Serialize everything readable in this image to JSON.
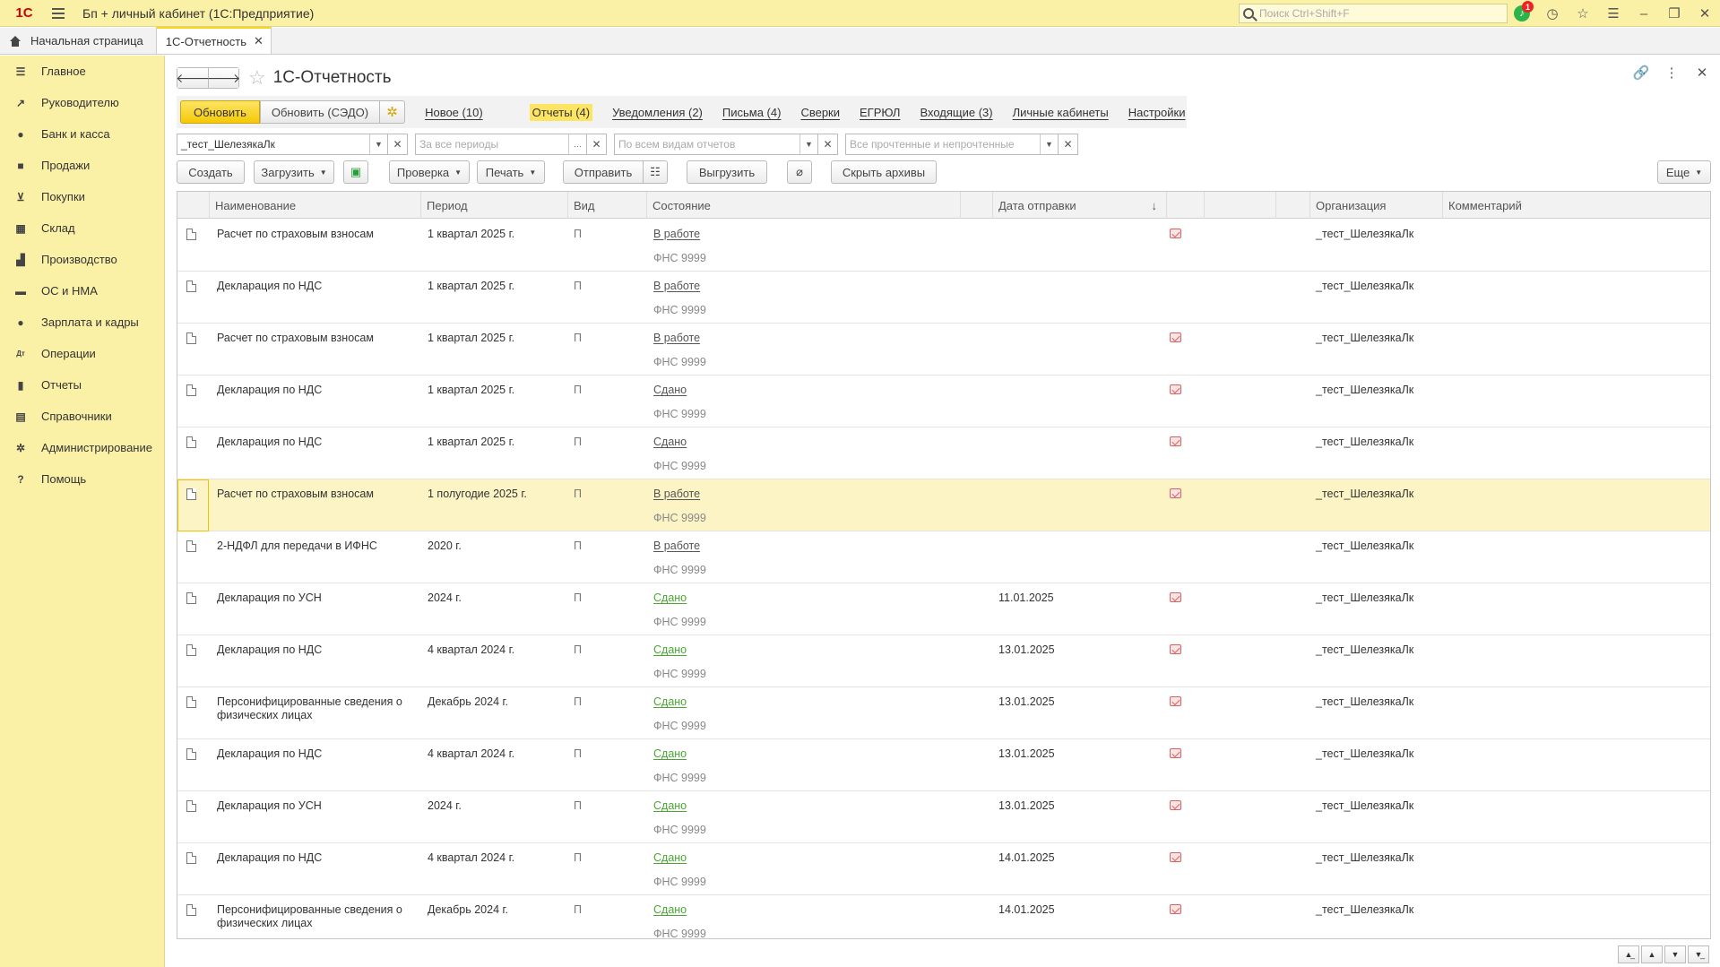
{
  "app": {
    "title": "Бп + личный кабинет  (1С:Предприятие)",
    "logo": "1С",
    "search_placeholder": "Поиск Ctrl+Shift+F",
    "notification_count": "1"
  },
  "tabs": {
    "home": "Начальная страница",
    "active": "1С-Отчетность"
  },
  "sidebar": {
    "items": [
      {
        "label": "Главное",
        "icon": "menu-icon"
      },
      {
        "label": "Руководителю",
        "icon": "trend-icon"
      },
      {
        "label": "Банк и касса",
        "icon": "coin-icon"
      },
      {
        "label": "Продажи",
        "icon": "bag-icon"
      },
      {
        "label": "Покупки",
        "icon": "cart-icon"
      },
      {
        "label": "Склад",
        "icon": "grid-icon"
      },
      {
        "label": "Производство",
        "icon": "factory-icon"
      },
      {
        "label": "ОС и НМА",
        "icon": "truck-icon"
      },
      {
        "label": "Зарплата и кадры",
        "icon": "person-icon"
      },
      {
        "label": "Операции",
        "icon": "dtkt-icon"
      },
      {
        "label": "Отчеты",
        "icon": "bars-icon"
      },
      {
        "label": "Справочники",
        "icon": "books-icon"
      },
      {
        "label": "Администрирование",
        "icon": "gear-icon"
      },
      {
        "label": "Помощь",
        "icon": "help-icon"
      }
    ]
  },
  "form": {
    "title": "1С-Отчетность"
  },
  "cmdbar1": {
    "refresh": "Обновить",
    "refresh_sedo": "Обновить (СЭДО)",
    "links": [
      "Новое (10)",
      "Отчеты (4)",
      "Уведомления (2)",
      "Письма (4)",
      "Сверки",
      "ЕГРЮЛ",
      "Входящие (3)",
      "Личные кабинеты",
      "Настройки"
    ]
  },
  "filters": {
    "org": "_тест_ШелезякаЛк",
    "period_placeholder": "За все периоды",
    "types_placeholder": "По всем видам отчетов",
    "read_placeholder": "Все прочтенные и непрочтенные"
  },
  "cmdbar2": {
    "create": "Создать",
    "load": "Загрузить",
    "check": "Проверка",
    "print": "Печать",
    "send": "Отправить",
    "export": "Выгрузить",
    "hide_archives": "Скрыть архивы",
    "more": "Еще"
  },
  "table": {
    "headers": {
      "name": "Наименование",
      "period": "Период",
      "kind": "Вид",
      "state": "Состояние",
      "sent": "Дата отправки",
      "org": "Организация",
      "comment": "Комментарий"
    },
    "rows": [
      {
        "name": "Расчет по страховым взносам",
        "name2": "",
        "period": "1 квартал 2025 г.",
        "kind": "П",
        "state": "В работе",
        "ok": false,
        "authority": "ФНС 9999",
        "sent": "",
        "env": true,
        "org": "_тест_ШелезякаЛк"
      },
      {
        "name": "Декларация по НДС",
        "name2": "",
        "period": "1 квартал 2025 г.",
        "kind": "П",
        "state": "В работе",
        "ok": false,
        "authority": "ФНС 9999",
        "sent": "",
        "env": false,
        "org": "_тест_ШелезякаЛк"
      },
      {
        "name": "Расчет по страховым взносам",
        "name2": "",
        "period": "1 квартал 2025 г.",
        "kind": "П",
        "state": "В работе",
        "ok": false,
        "authority": "ФНС 9999",
        "sent": "",
        "env": true,
        "org": "_тест_ШелезякаЛк"
      },
      {
        "name": "Декларация по НДС",
        "name2": "",
        "period": "1 квартал 2025 г.",
        "kind": "П",
        "state": "Сдано",
        "ok": false,
        "authority": "ФНС 9999",
        "sent": "",
        "env": true,
        "org": "_тест_ШелезякаЛк"
      },
      {
        "name": "Декларация по НДС",
        "name2": "",
        "period": "1 квартал 2025 г.",
        "kind": "П",
        "state": "Сдано",
        "ok": false,
        "authority": "ФНС 9999",
        "sent": "",
        "env": true,
        "org": "_тест_ШелезякаЛк"
      },
      {
        "name": "Расчет по страховым взносам",
        "name2": "",
        "period": "1 полугодие 2025 г.",
        "kind": "П",
        "state": "В работе",
        "ok": false,
        "authority": "ФНС 9999",
        "sent": "",
        "env": true,
        "org": "_тест_ШелезякаЛк",
        "selected": true
      },
      {
        "name": "2-НДФЛ для передачи в ИФНС",
        "name2": "",
        "period": "2020 г.",
        "kind": "П",
        "state": "В работе",
        "ok": false,
        "authority": "ФНС 9999",
        "sent": "",
        "env": false,
        "org": "_тест_ШелезякаЛк"
      },
      {
        "name": "Декларация по УСН",
        "name2": "",
        "period": "2024 г.",
        "kind": "П",
        "state": "Сдано",
        "ok": true,
        "authority": "ФНС 9999",
        "sent": "11.01.2025",
        "env": true,
        "org": "_тест_ШелезякаЛк"
      },
      {
        "name": "Декларация по НДС",
        "name2": "",
        "period": "4 квартал 2024 г.",
        "kind": "П",
        "state": "Сдано",
        "ok": true,
        "authority": "ФНС 9999",
        "sent": "13.01.2025",
        "env": true,
        "org": "_тест_ШелезякаЛк"
      },
      {
        "name": "Персонифицированные сведения о",
        "name2": "физических лицах",
        "period": "Декабрь 2024 г.",
        "kind": "П",
        "state": "Сдано",
        "ok": true,
        "authority": "ФНС 9999",
        "sent": "13.01.2025",
        "env": true,
        "org": "_тест_ШелезякаЛк"
      },
      {
        "name": "Декларация по НДС",
        "name2": "",
        "period": "4 квартал 2024 г.",
        "kind": "П",
        "state": "Сдано",
        "ok": true,
        "authority": "ФНС 9999",
        "sent": "13.01.2025",
        "env": true,
        "org": "_тест_ШелезякаЛк"
      },
      {
        "name": "Декларация по УСН",
        "name2": "",
        "period": "2024 г.",
        "kind": "П",
        "state": "Сдано",
        "ok": true,
        "authority": "ФНС 9999",
        "sent": "13.01.2025",
        "env": true,
        "org": "_тест_ШелезякаЛк"
      },
      {
        "name": "Декларация по НДС",
        "name2": "",
        "period": "4 квартал 2024 г.",
        "kind": "П",
        "state": "Сдано",
        "ok": true,
        "authority": "ФНС 9999",
        "sent": "14.01.2025",
        "env": true,
        "org": "_тест_ШелезякаЛк"
      },
      {
        "name": "Персонифицированные сведения о",
        "name2": "физических лицах",
        "period": "Декабрь 2024 г.",
        "kind": "П",
        "state": "Сдано",
        "ok": true,
        "authority": "ФНС 9999",
        "sent": "14.01.2025",
        "env": true,
        "org": "_тест_ШелезякаЛк"
      }
    ]
  }
}
